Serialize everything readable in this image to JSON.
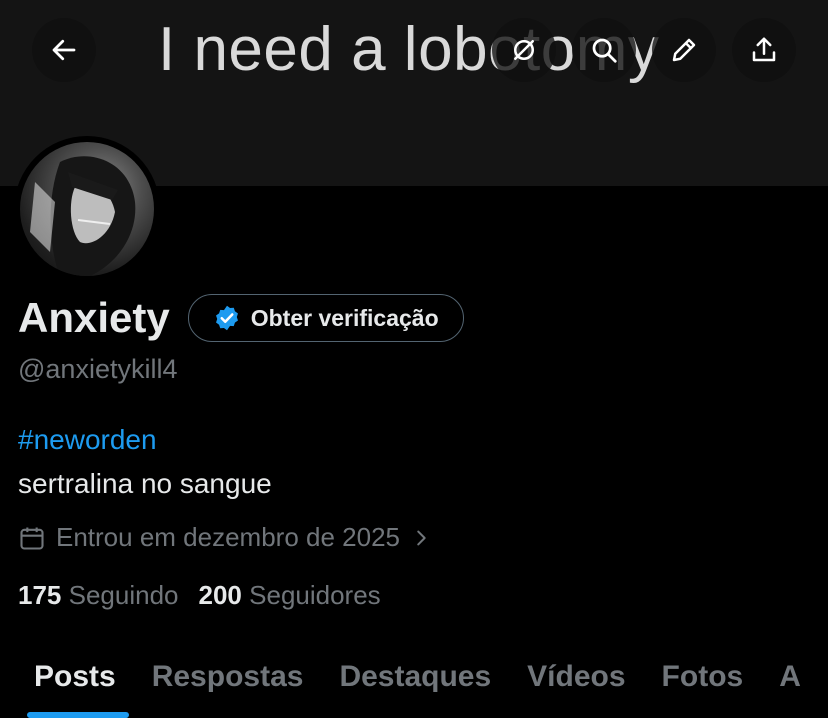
{
  "banner": {
    "text": "I need a lobotomy"
  },
  "header_icons": [
    "back-arrow-icon",
    "grok-icon",
    "search-icon",
    "edit-icon",
    "share-icon"
  ],
  "profile": {
    "name": "Anxiety",
    "verify_label": "Obter verificação",
    "handle": "@anxietykill4",
    "hashtag": "#neworden",
    "bio": "sertralina no sangue",
    "joined": "Entrou em dezembro de 2025",
    "following_count": "175",
    "following_label": "Seguindo",
    "followers_count": "200",
    "followers_label": "Seguidores"
  },
  "tabs": [
    {
      "label": "Posts",
      "active": true
    },
    {
      "label": "Respostas",
      "active": false
    },
    {
      "label": "Destaques",
      "active": false
    },
    {
      "label": "Vídeos",
      "active": false
    },
    {
      "label": "Fotos",
      "active": false
    },
    {
      "label": "A",
      "active": false
    }
  ],
  "colors": {
    "accent": "#1d9bf0",
    "muted": "#71767b",
    "text": "#e7e9ea",
    "background": "#000000"
  }
}
